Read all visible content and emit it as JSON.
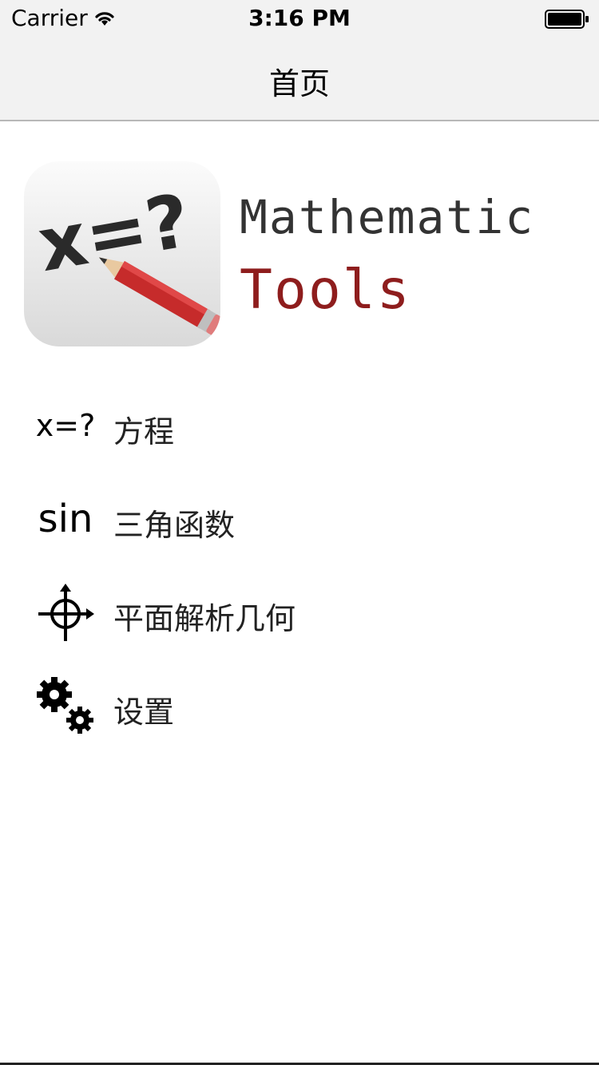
{
  "status_bar": {
    "carrier": "Carrier",
    "time": "3:16 PM"
  },
  "nav": {
    "title": "首页"
  },
  "logo": {
    "tile_text": "x=?",
    "line1": "Mathematic",
    "line2": "Tools",
    "line1_color": "#333333",
    "line2_color": "#8e1d1d"
  },
  "menu": {
    "items": [
      {
        "icon": "x=?",
        "icon_name": "equation-icon",
        "label": "方程"
      },
      {
        "icon": "sin",
        "icon_name": "sine-icon",
        "label": "三角函数"
      },
      {
        "icon": "",
        "icon_name": "crosshair-icon",
        "label": "平面解析几何"
      },
      {
        "icon": "",
        "icon_name": "gears-icon",
        "label": "设置"
      }
    ]
  }
}
